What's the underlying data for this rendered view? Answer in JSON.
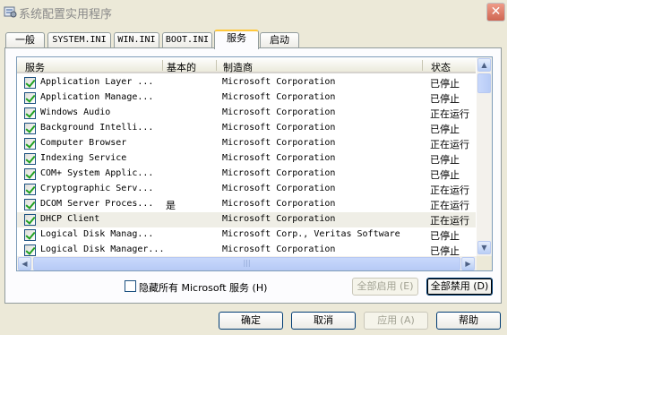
{
  "window": {
    "title": "系统配置实用程序",
    "close": "✕"
  },
  "tabs": [
    {
      "label": "一般"
    },
    {
      "label": "SYSTEM.INI"
    },
    {
      "label": "WIN.INI"
    },
    {
      "label": "BOOT.INI"
    },
    {
      "label": "服务"
    },
    {
      "label": "启动"
    }
  ],
  "active_tab": "服务",
  "list": {
    "columns": [
      "服务",
      "基本的",
      "制造商",
      "状态"
    ],
    "rows": [
      {
        "checked": true,
        "service": "Application Layer ...",
        "essential": "",
        "manufacturer": "Microsoft Corporation",
        "status": "已停止"
      },
      {
        "checked": true,
        "service": "Application Manage...",
        "essential": "",
        "manufacturer": "Microsoft Corporation",
        "status": "已停止"
      },
      {
        "checked": true,
        "service": "Windows Audio",
        "essential": "",
        "manufacturer": "Microsoft Corporation",
        "status": "正在运行"
      },
      {
        "checked": true,
        "service": "Background Intelli...",
        "essential": "",
        "manufacturer": "Microsoft Corporation",
        "status": "已停止"
      },
      {
        "checked": true,
        "service": "Computer Browser",
        "essential": "",
        "manufacturer": "Microsoft Corporation",
        "status": "正在运行"
      },
      {
        "checked": true,
        "service": "Indexing Service",
        "essential": "",
        "manufacturer": "Microsoft Corporation",
        "status": "已停止"
      },
      {
        "checked": true,
        "service": "COM+ System Applic...",
        "essential": "",
        "manufacturer": "Microsoft Corporation",
        "status": "已停止"
      },
      {
        "checked": true,
        "service": "Cryptographic Serv...",
        "essential": "",
        "manufacturer": "Microsoft Corporation",
        "status": "正在运行"
      },
      {
        "checked": true,
        "service": "DCOM Server Proces...",
        "essential": "是",
        "manufacturer": "Microsoft Corporation",
        "status": "正在运行"
      },
      {
        "checked": true,
        "service": "DHCP Client",
        "essential": "",
        "manufacturer": "Microsoft Corporation",
        "status": "正在运行",
        "selected": true
      },
      {
        "checked": true,
        "service": "Logical Disk Manag...",
        "essential": "",
        "manufacturer": "Microsoft Corp., Veritas Software",
        "status": "已停止"
      },
      {
        "checked": true,
        "service": "Logical Disk Manager...",
        "essential": "",
        "manufacturer": "Microsoft Corporation",
        "status": "已停止"
      }
    ]
  },
  "scroll": {
    "up": "▲",
    "down": "▼",
    "left": "◀",
    "right": "▶",
    "grip": "|||"
  },
  "hide_ms": {
    "label": "隐藏所有 Microsoft 服务 (H)",
    "checked": false
  },
  "panel_buttons": {
    "enable_all": "全部启用 (E)",
    "disable_all": "全部禁用 (D)"
  },
  "buttons": {
    "ok": "确定",
    "cancel": "取消",
    "apply": "应用 (A)",
    "help": "帮助"
  }
}
